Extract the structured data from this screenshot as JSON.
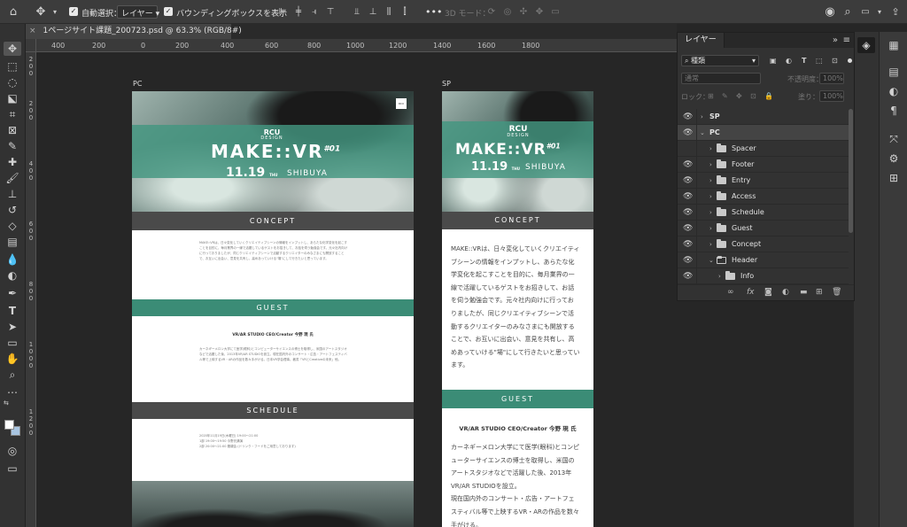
{
  "options_bar": {
    "auto_select_label": "自動選択：",
    "auto_select_target": "レイヤー",
    "bounding_box_label": "バウンディングボックスを表示",
    "more": "•••",
    "mode_3d_label": "3D モード："
  },
  "document": {
    "tab_title": "1ページサイト課題_200723.psd @ 63.3% (RGB/8#)",
    "close_glyph": "×"
  },
  "ruler": {
    "top_ticks": [
      "400",
      "200",
      "0",
      "200",
      "400",
      "600",
      "800",
      "1000",
      "1200",
      "1400",
      "1600",
      "1800"
    ],
    "left_ticks": [
      "2",
      "0",
      "0",
      "2",
      "0",
      "0",
      "4",
      "0",
      "0",
      "6",
      "0",
      "0",
      "8",
      "0",
      "0",
      "1",
      "0",
      "0",
      "0",
      "1",
      "2",
      "0",
      "0"
    ]
  },
  "artboards": {
    "pc": {
      "label": "PC",
      "hero": {
        "logo": "RCU",
        "logo_sub": "DESIGN",
        "title": "MAKE::VR",
        "title_num": "#01",
        "date": "11.19",
        "date_weekday": "THU",
        "venue": "SHIBUYA",
        "badge": "RCU"
      },
      "concept_heading": "CONCEPT",
      "concept_text": "MAKE::VRは、日々変化していくクリエイティブシーンの情報をインプットし、あらたな化学変化を起こすことを目的に、毎月業界の一線で活躍しているゲストをお招きして、お話を伺う勉強会です。元々社内向けに行っておりましたが、同じクリエイティブシーンで活動するクリエイターのみなさまにも開放することで、お互いに出会い、意見を共有し、高めあっていける\"場\"にして行きたいと思っています。",
      "guest_heading": "GUEST",
      "guest_name": "VR/AR STUDIO CEO/Creator 今野 現 氏",
      "guest_text": "カーネギーメロン大学にて医学(眼科)とコンピューターサイエンスの博士を取得し、米国のアートスタジオなどで活躍した後、2013年VR/AR STUDIOを設立。現在国内外のコンサート・広告・アートフェスティバル等で上映するVR・ARの作品を数々手がける。日本VR学会理事。著書「VRとCreativeの未来」他。",
      "schedule_heading": "SCHEDULE",
      "schedule_lines": [
        "2020年11月19日(木曜日) 19:00〜21:00",
        "1部 19:00〜19:50 今野氏講演",
        "2部 20:00〜21:00 懇親会 (ドリンク・フードをご用意しております)"
      ]
    },
    "sp": {
      "label": "SP",
      "hero": {
        "logo": "RCU",
        "logo_sub": "DESIGN",
        "title": "MAKE::VR",
        "title_num": "#01",
        "date": "11.19",
        "date_weekday": "THU",
        "venue": "SHIBUYA"
      },
      "concept_heading": "CONCEPT",
      "concept_lines": [
        "MAKE::VRは、日々変化していくクリエイティ",
        "ブシーンの情報をインプットし、あらたな化",
        "学変化を起こすことを目的に、毎月業界の一",
        "線で活躍しているゲストをお招きして、お話",
        "を伺う勉強会です。元々社内向けに行ってお",
        "りましたが、同じクリエイティブシーンで活",
        "動するクリエイターのみなさまにも開放する",
        "ことで、お互いに出会い、意見を共有し、高",
        "めあっていける\"場\"にして行きたいと思ってい",
        "ます。"
      ],
      "guest_heading": "GUEST",
      "guest_name": "VR/AR STUDIO CEO/Creator 今野 現 氏",
      "guest_lines": [
        "カーネギーメロン大学にて医学(眼科)とコンピ",
        "ューターサイエンスの博士を取得し、米国の",
        "アートスタジオなどで活躍した後、2013年",
        "VR/AR STUDIOを設立。",
        "現在国内外のコンサート・広告・アートフェ",
        "スティバル等で上映するVR・ARの作品を数々",
        "手がける。"
      ]
    }
  },
  "layers_panel": {
    "tab_label": "レイヤー",
    "expand": "»",
    "menu": "≡",
    "filter_label": "種類",
    "blend_mode": "通常",
    "opacity_label": "不透明度：",
    "opacity_value": "100%",
    "lock_label": "ロック：",
    "fill_label": "塗り：",
    "fill_value": "100%",
    "layers": [
      {
        "name": "SP",
        "level": 0,
        "visible": true,
        "expanded": false,
        "folder": false
      },
      {
        "name": "PC",
        "level": 0,
        "visible": true,
        "expanded": true,
        "folder": false
      },
      {
        "name": "Spacer",
        "level": 1,
        "visible": false,
        "expanded": false,
        "folder": true
      },
      {
        "name": "Footer",
        "level": 1,
        "visible": true,
        "expanded": false,
        "folder": true
      },
      {
        "name": "Entry",
        "level": 1,
        "visible": true,
        "expanded": false,
        "folder": true
      },
      {
        "name": "Access",
        "level": 1,
        "visible": true,
        "expanded": false,
        "folder": true
      },
      {
        "name": "Schedule",
        "level": 1,
        "visible": true,
        "expanded": false,
        "folder": true
      },
      {
        "name": "Guest",
        "level": 1,
        "visible": true,
        "expanded": false,
        "folder": true
      },
      {
        "name": "Concept",
        "level": 1,
        "visible": true,
        "expanded": false,
        "folder": true
      },
      {
        "name": "Header",
        "level": 1,
        "visible": true,
        "expanded": true,
        "folder": true
      },
      {
        "name": "Info",
        "level": 2,
        "visible": true,
        "expanded": false,
        "folder": true
      }
    ],
    "footer_icons": [
      "link-icon",
      "fx-icon",
      "mask-icon",
      "adjustment-icon",
      "group-icon",
      "new-layer-icon",
      "trash-icon"
    ]
  },
  "colors": {
    "accent_green": "#3b8c76",
    "dark_bar": "#4a4a4a",
    "panel_bg": "#323232",
    "canvas_bg": "#262626"
  }
}
